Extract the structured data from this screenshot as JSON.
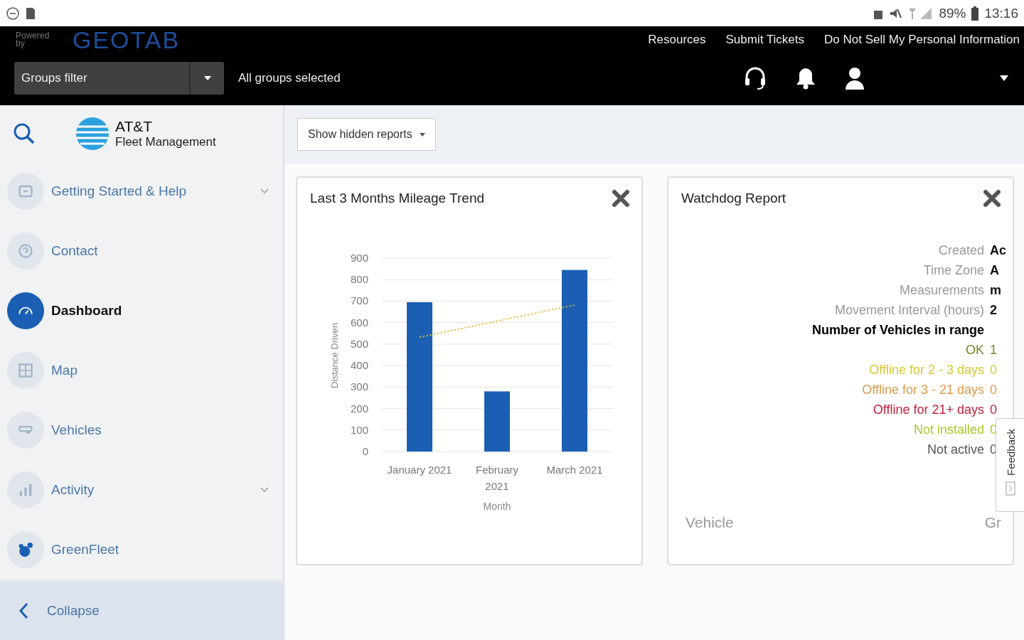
{
  "status_bar": {
    "battery": "89%",
    "time": "13:16"
  },
  "header": {
    "brand_prefix": "Powered by",
    "brand": "GEOTAB",
    "links": [
      "Resources",
      "Submit Tickets",
      "Do Not Sell My Personal Information"
    ],
    "groups_filter": {
      "placeholder": "Groups filter"
    },
    "groups_status": "All groups selected"
  },
  "sidebar": {
    "brand": {
      "title": "AT&T",
      "subtitle": "Fleet Management"
    },
    "items": [
      {
        "label": "Getting Started & Help",
        "expandable": true,
        "selected": false
      },
      {
        "label": "Contact",
        "expandable": false,
        "selected": false
      },
      {
        "label": "Dashboard",
        "expandable": false,
        "selected": true
      },
      {
        "label": "Map",
        "expandable": false,
        "selected": false
      },
      {
        "label": "Vehicles",
        "expandable": false,
        "selected": false
      },
      {
        "label": "Activity",
        "expandable": true,
        "selected": false
      },
      {
        "label": "GreenFleet",
        "expandable": false,
        "selected": false
      }
    ],
    "collapse": "Collapse"
  },
  "toolbar": {
    "button": "Show hidden reports"
  },
  "cards": [
    {
      "kind": "chart",
      "title": "Last 3 Months Mileage Trend",
      "chart_data": {
        "type": "bar",
        "xlabel": "Month",
        "ylabel": "Distance Driven",
        "categories": [
          "January 2021",
          "February 2021",
          "March 2021"
        ],
        "series": [
          {
            "type": "bar",
            "color": "#1a5fb4",
            "values": [
              695,
              280,
              845
            ]
          },
          {
            "type": "line",
            "color": "#e0b830",
            "line_style": "dotted",
            "values": [
              532,
              607,
              682
            ]
          }
        ],
        "grid": true,
        "ylim": [
          0,
          900
        ],
        "yticks": [
          0,
          100,
          200,
          300,
          400,
          500,
          600,
          700,
          800,
          900
        ]
      }
    },
    {
      "kind": "watchdog",
      "title": "Watchdog Report",
      "fields": [
        {
          "label": "Created",
          "value": "Ac"
        },
        {
          "label": "Time Zone",
          "value": "A"
        },
        {
          "label": "Measurements",
          "value": "m"
        },
        {
          "label": "Movement Interval (hours)",
          "value": "2"
        }
      ],
      "heading": "Number of Vehicles in range",
      "ranges": [
        {
          "label": "OK",
          "count": "1",
          "color": "#6f8a2a"
        },
        {
          "label": "Offline for 2 - 3 days",
          "count": "0",
          "color": "#d8c830"
        },
        {
          "label": "Offline for 3 - 21 days",
          "count": "0",
          "color": "#dc9a4a"
        },
        {
          "label": "Offline for 21+ days",
          "count": "0",
          "color": "#c0203c"
        },
        {
          "label": "Not installed",
          "count": "0",
          "color": "#a8c82a"
        },
        {
          "label": "Not active",
          "count": "0",
          "color": "#555555"
        }
      ],
      "columns": [
        "Vehicle",
        "Gr"
      ]
    }
  ],
  "feedback": "Feedback"
}
